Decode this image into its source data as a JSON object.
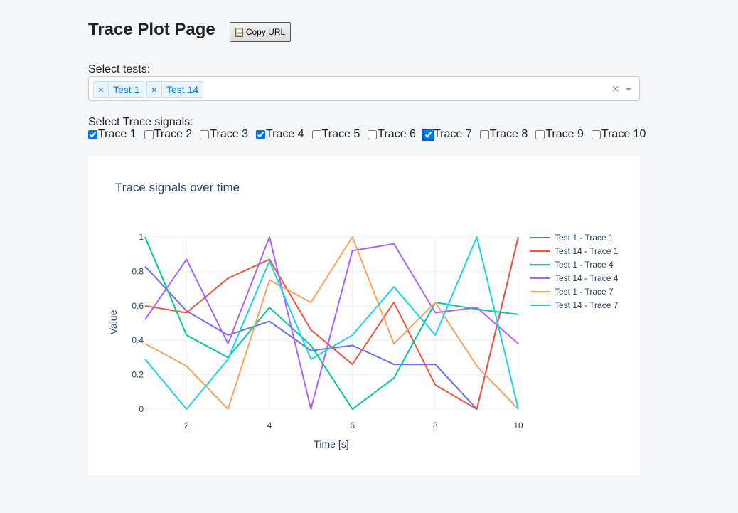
{
  "page": {
    "title": "Trace Plot Page",
    "copy_button_label": "Copy URL"
  },
  "tests_select": {
    "label": "Select tests:",
    "selected": [
      {
        "remove": "×",
        "label": "Test 1"
      },
      {
        "remove": "×",
        "label": "Test 14"
      }
    ],
    "clear": "×"
  },
  "signals": {
    "label": "Select Trace signals:",
    "options": [
      {
        "label": "Trace 1",
        "checked": true
      },
      {
        "label": "Trace 2",
        "checked": false
      },
      {
        "label": "Trace 3",
        "checked": false
      },
      {
        "label": "Trace 4",
        "checked": true
      },
      {
        "label": "Trace 5",
        "checked": false
      },
      {
        "label": "Trace 6",
        "checked": false
      },
      {
        "label": "Trace 7",
        "checked": true
      },
      {
        "label": "Trace 8",
        "checked": false
      },
      {
        "label": "Trace 9",
        "checked": false
      },
      {
        "label": "Trace 10",
        "checked": false
      }
    ]
  },
  "chart_data": {
    "type": "line",
    "title": "Trace signals over time",
    "xlabel": "Time [s]",
    "ylabel": "Value",
    "xlim": [
      1,
      10
    ],
    "ylim": [
      0,
      1
    ],
    "x_ticks": [
      2,
      4,
      6,
      8,
      10
    ],
    "y_ticks": [
      0,
      0.2,
      0.4,
      0.6,
      0.8,
      1
    ],
    "y_tick_labels": [
      "0",
      "0.2",
      "0.4",
      "0.6",
      "0.8",
      "1"
    ],
    "grid": true,
    "legend_position": "right",
    "x": [
      1,
      2,
      3,
      4,
      5,
      6,
      7,
      8,
      9,
      10
    ],
    "series": [
      {
        "name": "Test 1 - Trace 1",
        "color": "#636efa",
        "values": [
          0.83,
          0.57,
          0.43,
          0.51,
          0.34,
          0.37,
          0.26,
          0.26,
          0.0,
          1.0
        ]
      },
      {
        "name": "Test 14 - Trace 1",
        "color": "#ef553b",
        "values": [
          0.6,
          0.56,
          0.76,
          0.87,
          0.46,
          0.26,
          0.62,
          0.14,
          0.0,
          1.0
        ]
      },
      {
        "name": "Test 1 - Trace 4",
        "color": "#00cc96",
        "values": [
          1.0,
          0.43,
          0.3,
          0.59,
          0.37,
          0.0,
          0.18,
          0.62,
          0.58,
          0.55
        ]
      },
      {
        "name": "Test 14 - Trace 4",
        "color": "#ab63fa",
        "values": [
          0.52,
          0.87,
          0.38,
          1.0,
          0.0,
          0.92,
          0.96,
          0.56,
          0.59,
          0.38
        ]
      },
      {
        "name": "Test 1 - Trace 7",
        "color": "#ffa15a",
        "values": [
          0.38,
          0.25,
          0.0,
          0.75,
          0.62,
          1.0,
          0.38,
          0.62,
          0.25,
          0.0
        ]
      },
      {
        "name": "Test 14 - Trace 7",
        "color": "#19d3f3",
        "values": [
          0.29,
          0.0,
          0.29,
          0.86,
          0.29,
          0.43,
          0.71,
          0.43,
          1.0,
          0.0
        ]
      }
    ]
  }
}
